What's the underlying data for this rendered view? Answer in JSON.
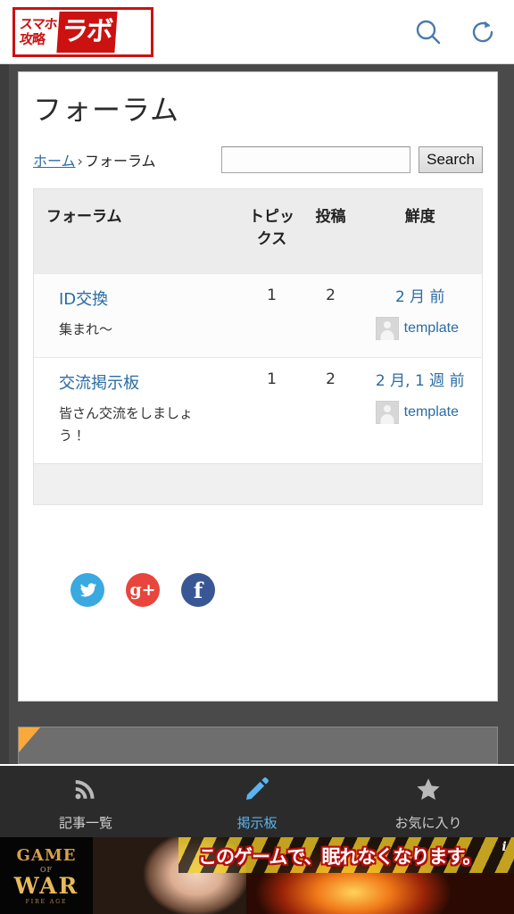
{
  "browser": {
    "logo": {
      "line1": "スマホ",
      "line2": "攻略",
      "main": "ラボ",
      "alt": "スマホ攻略ラボ"
    },
    "search_icon": "search-icon",
    "reload_icon": "reload-icon"
  },
  "page": {
    "title": "フォーラム",
    "breadcrumb": {
      "home": "ホーム",
      "separator": "›",
      "current": "フォーラム"
    },
    "search": {
      "value": "",
      "placeholder": "",
      "button_label": "Search"
    }
  },
  "table": {
    "headers": {
      "forum": "フォーラム",
      "topics": "トピックス",
      "posts": "投稿",
      "freshness": "鮮度"
    },
    "rows": [
      {
        "name": "ID交換",
        "description": "集まれ～",
        "topics": "1",
        "posts": "2",
        "freshness": "2 月 前",
        "user": "template"
      },
      {
        "name": "交流掲示板",
        "description": "皆さん交流をしましょう！",
        "topics": "1",
        "posts": "2",
        "freshness": "2 月, 1 週 前",
        "user": "template"
      }
    ]
  },
  "social": [
    {
      "name": "twitter",
      "glyph": "",
      "label": "Twitter",
      "color": "#3aa9e0"
    },
    {
      "name": "googleplus",
      "glyph": "g+",
      "label": "Google+",
      "color": "#e8453c"
    },
    {
      "name": "facebook",
      "glyph": "f",
      "label": "Facebook",
      "color": "#3a5795"
    }
  ],
  "bottom_nav": [
    {
      "icon": "rss-icon",
      "label": "記事一覧",
      "active": false
    },
    {
      "icon": "pencil-icon",
      "label": "掲示板",
      "active": true
    },
    {
      "icon": "star-icon",
      "label": "お気に入り",
      "active": false
    }
  ],
  "ad": {
    "logo_game": "GAME",
    "logo_of": "OF",
    "logo_war": "WAR",
    "logo_sub": "FIRE AGE",
    "headline": "このゲームで、眠れなくなります。",
    "info_label": "i"
  },
  "colors": {
    "brand_red": "#cc1111",
    "link_blue": "#2b6ca3",
    "nav_active": "#5bb4f0",
    "canvas": "#4a4a4a"
  }
}
